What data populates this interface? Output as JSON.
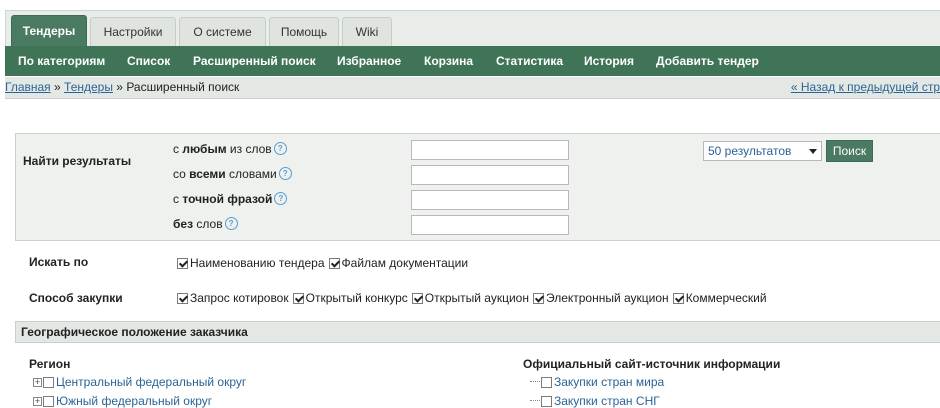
{
  "tabs": [
    {
      "label": "Тендеры",
      "active": true
    },
    {
      "label": "Настройки",
      "active": false
    },
    {
      "label": "О системе",
      "active": false
    },
    {
      "label": "Помощь",
      "active": false
    },
    {
      "label": "Wiki",
      "active": false
    }
  ],
  "menu": [
    "По категориям",
    "Список",
    "Расширенный поиск",
    "Избранное",
    "Корзина",
    "Статистика",
    "История",
    "Добавить тендер"
  ],
  "breadcrumb": {
    "home": "Главная",
    "sep1": " » ",
    "tenders": "Тендеры",
    "sep2": " » ",
    "current": "Расширенный поиск",
    "back": "« Назад к предыдущей стр"
  },
  "search": {
    "find_label": "Найти результаты",
    "rows": [
      {
        "prefix": "с ",
        "bold": "любым",
        "suffix": " из слов",
        "value": ""
      },
      {
        "prefix": "со ",
        "bold": "всеми",
        "suffix": " словами",
        "value": ""
      },
      {
        "prefix": "с ",
        "bold": "точной фразой",
        "suffix": "",
        "value": ""
      },
      {
        "prefix": "",
        "bold": "без",
        "suffix": " слов",
        "value": ""
      }
    ],
    "help_glyph": "?",
    "results_select": "50 результатов",
    "search_button": "Поиск"
  },
  "search_by": {
    "label": "Искать по",
    "options": [
      {
        "label": "Наименованию тендера",
        "checked": true
      },
      {
        "label": "Файлам документации",
        "checked": true
      }
    ]
  },
  "procurement": {
    "label": "Способ закупки",
    "options": [
      {
        "label": "Запрос котировок",
        "checked": true
      },
      {
        "label": "Открытый конкурс",
        "checked": true
      },
      {
        "label": "Открытый аукцион",
        "checked": true
      },
      {
        "label": "Электронный аукцион",
        "checked": true
      },
      {
        "label": "Коммерческий",
        "checked": true
      }
    ]
  },
  "geo": {
    "header": "Географическое положение заказчика",
    "region_title": "Регион",
    "regions": [
      "Центральный федеральный округ",
      "Южный федеральный округ"
    ],
    "source_title": "Официальный сайт-источник информации",
    "sources": [
      "Закупки стран мира",
      "Закупки стран СНГ"
    ]
  },
  "colors": {
    "accent": "#4a7a62",
    "menu_bg": "#3f7457",
    "link": "#2a6496"
  }
}
